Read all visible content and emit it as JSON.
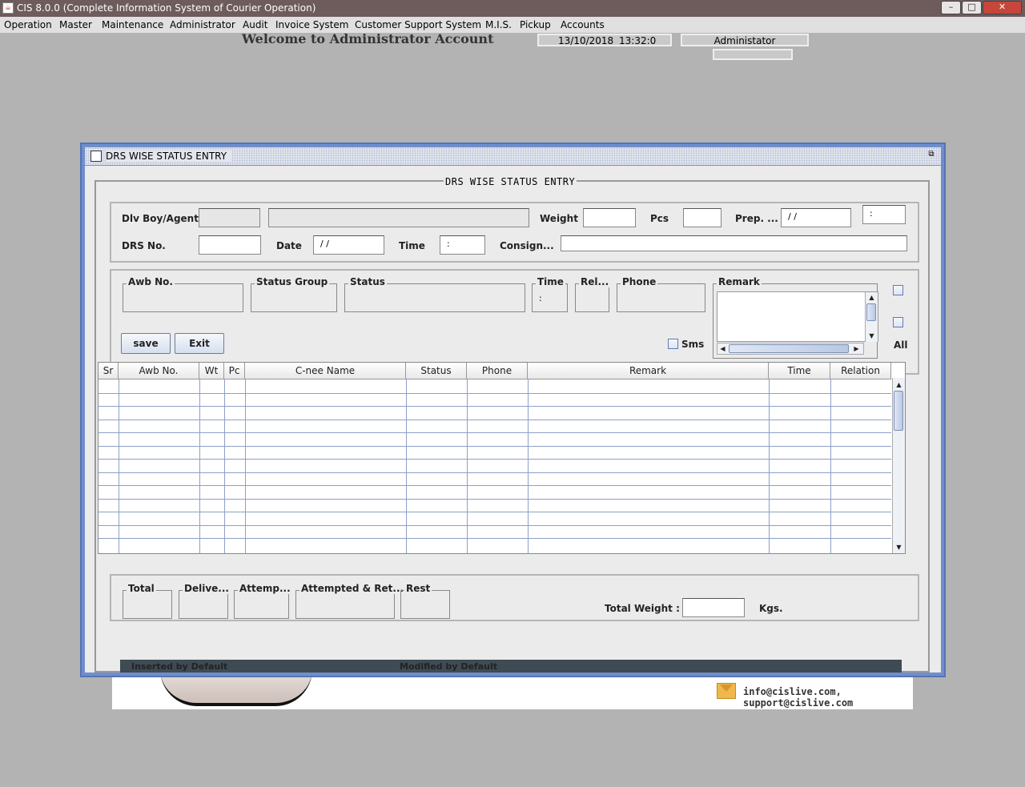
{
  "window": {
    "title": "CIS 8.0.0 (Complete Information System of Courier Operation)",
    "min": "–",
    "max": "□",
    "close": "✕"
  },
  "menu": [
    "Operation",
    "Master",
    "Maintenance",
    "Administrator",
    "Audit",
    "Invoice System",
    "Customer Support System",
    "M.I.S.",
    "Pickup",
    "Accounts"
  ],
  "header": {
    "welcome": "Welcome to Administrator Account",
    "date": "13/10/2018",
    "time": "13:32:0",
    "user": "Administator"
  },
  "frame": {
    "title": "DRS WISE STATUS ENTRY",
    "section_title": "DRS WISE STATUS ENTRY"
  },
  "form": {
    "dlv_label": "Dlv Boy/Agent",
    "weight_label": "Weight",
    "pcs_label": "Pcs",
    "prep_label": "Prep. ...",
    "prep_date": "/ /",
    "prep_time": ":",
    "drs_label": "DRS No.",
    "date_label": "Date",
    "date_value": "/ /",
    "time_label": "Time",
    "time_value": ":",
    "consign_label": "Consign..."
  },
  "entry": {
    "awb_label": "Awb No.",
    "status_group_label": "Status Group",
    "status_label": "Status",
    "time_label": "Time",
    "time_value": ":",
    "rel_label": "Rel...",
    "phone_label": "Phone",
    "remark_label": "Remark",
    "save_label": "save",
    "exit_label": "Exit",
    "sms_label": "Sms",
    "all_label": "All"
  },
  "table": {
    "columns": [
      "Sr",
      "Awb No.",
      "Wt",
      "Pc",
      "C-nee Name",
      "Status",
      "Phone",
      "Remark",
      "Time",
      "Relation"
    ]
  },
  "summary": {
    "total_label": "Total",
    "delivered_label": "Delive...",
    "attempted_label": "Attemp...",
    "attempted_ret_label": "Attempted & Ret...",
    "rest_label": "Rest",
    "total_weight_label": "Total Weight :",
    "kgs_label": "Kgs."
  },
  "status_bar": {
    "inserted": "Inserted by    Default",
    "modified": "Modified by  Default"
  },
  "footer": {
    "email": "info@cislive.com, support@cislive.com"
  },
  "colors": {
    "frame_border": "#6f8ecb",
    "title_bar": "#6e5b5b",
    "grid_lines": "#8da0c8"
  }
}
